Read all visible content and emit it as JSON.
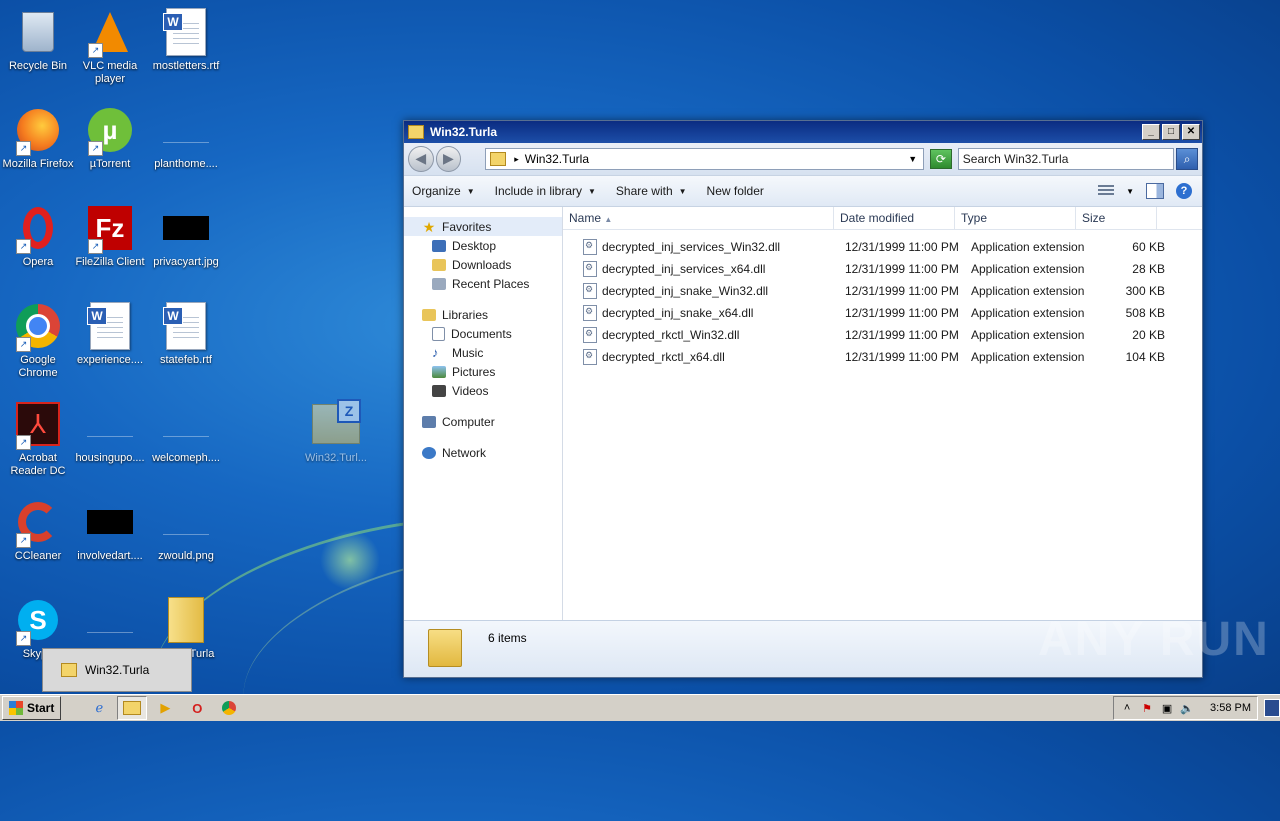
{
  "desktop": {
    "icons": [
      {
        "label": "Recycle Bin"
      },
      {
        "label": "VLC media player"
      },
      {
        "label": "mostletters.rtf"
      },
      {
        "label": "Mozilla Firefox"
      },
      {
        "label": "µTorrent"
      },
      {
        "label": "planthome...."
      },
      {
        "label": "Opera"
      },
      {
        "label": "FileZilla Client"
      },
      {
        "label": "privacyart.jpg"
      },
      {
        "label": "Google Chrome"
      },
      {
        "label": "experience...."
      },
      {
        "label": "statefeb.rtf"
      },
      {
        "label": "Acrobat Reader DC"
      },
      {
        "label": "housingupo...."
      },
      {
        "label": "welcomeph...."
      },
      {
        "label": "Win32.Turl..."
      },
      {
        "label": "CCleaner"
      },
      {
        "label": "involvedart...."
      },
      {
        "label": "zwould.png"
      },
      {
        "label": "Skype"
      },
      {
        "label": "Turla"
      }
    ],
    "watermark": "ANY RUN"
  },
  "window": {
    "title": "Win32.Turla",
    "address": "Win32.Turla",
    "search_placeholder": "Search Win32.Turla",
    "toolbar": {
      "organize": "Organize",
      "include": "Include in library",
      "share": "Share with",
      "newfolder": "New folder"
    },
    "nav": {
      "favorites": "Favorites",
      "desktop": "Desktop",
      "downloads": "Downloads",
      "recent": "Recent Places",
      "libraries": "Libraries",
      "documents": "Documents",
      "music": "Music",
      "pictures": "Pictures",
      "videos": "Videos",
      "computer": "Computer",
      "network": "Network"
    },
    "columns": {
      "name": "Name",
      "date": "Date modified",
      "type": "Type",
      "size": "Size"
    },
    "files": [
      {
        "name": "decrypted_inj_services_Win32.dll",
        "date": "12/31/1999 11:00 PM",
        "type": "Application extension",
        "size": "60 KB"
      },
      {
        "name": "decrypted_inj_services_x64.dll",
        "date": "12/31/1999 11:00 PM",
        "type": "Application extension",
        "size": "28 KB"
      },
      {
        "name": "decrypted_inj_snake_Win32.dll",
        "date": "12/31/1999 11:00 PM",
        "type": "Application extension",
        "size": "300 KB"
      },
      {
        "name": "decrypted_inj_snake_x64.dll",
        "date": "12/31/1999 11:00 PM",
        "type": "Application extension",
        "size": "508 KB"
      },
      {
        "name": "decrypted_rkctl_Win32.dll",
        "date": "12/31/1999 11:00 PM",
        "type": "Application extension",
        "size": "20 KB"
      },
      {
        "name": "decrypted_rkctl_x64.dll",
        "date": "12/31/1999 11:00 PM",
        "type": "Application extension",
        "size": "104 KB"
      }
    ],
    "item_count": "6 items"
  },
  "taskbar": {
    "start": "Start",
    "popup_label": "Win32.Turla",
    "clock": "3:58 PM"
  }
}
